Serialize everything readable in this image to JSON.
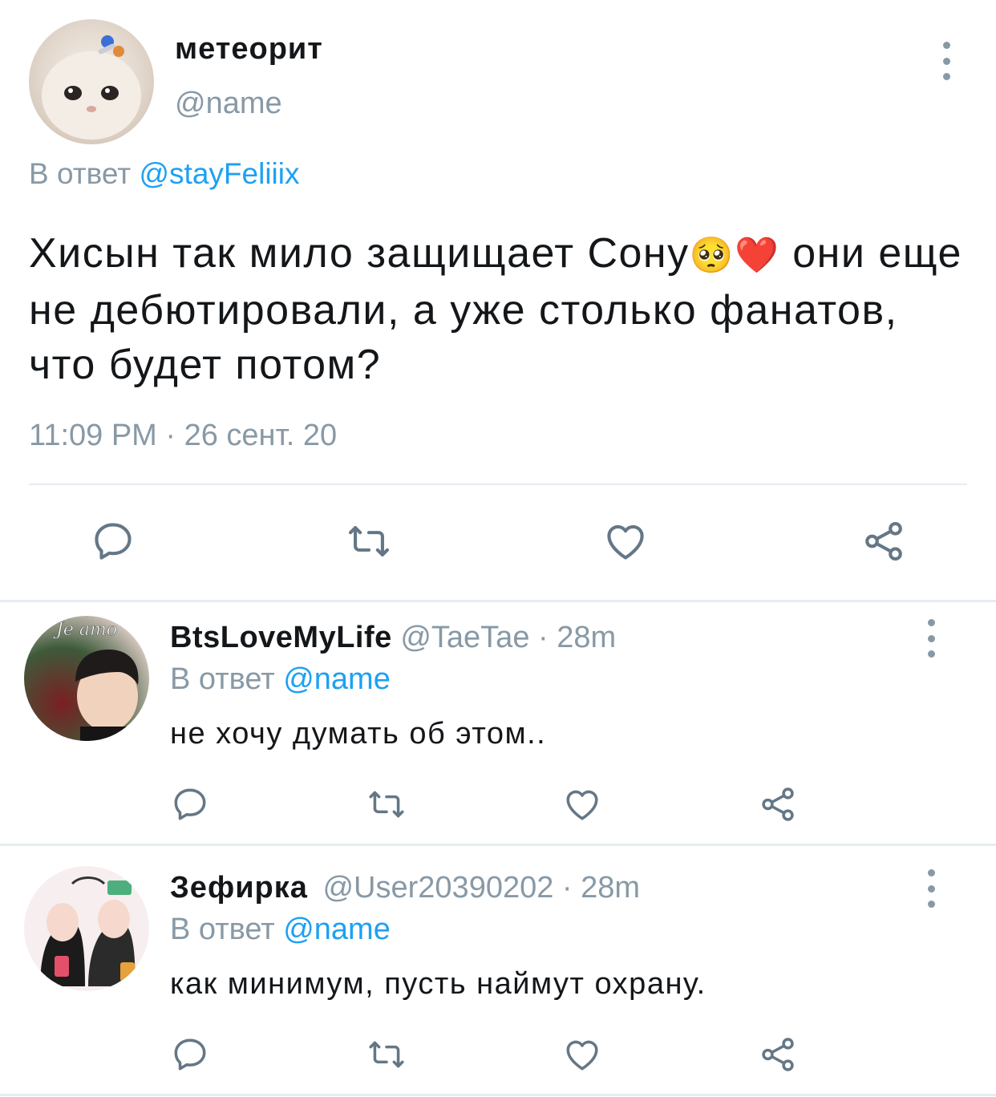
{
  "main_tweet": {
    "display_name": "метеорит",
    "handle": "@name",
    "reply_prefix": "В ответ",
    "reply_to": "@stayFeliiix",
    "text_part1": "Хисын так мило защищает Сону",
    "emoji1": "🥺",
    "emoji2": "❤️",
    "text_part2": "они еще не дебютировали, а уже столько фанатов, что будет потом?",
    "timestamp": "11:09 PM · 26 сент. 20"
  },
  "replies": [
    {
      "display_name": "BtsLoveMyLife",
      "meta": "@TaeTae · 28m",
      "reply_prefix": "В ответ",
      "reply_to": "@name",
      "text": "не хочу думать об этом..",
      "avatar_text": "Je amo"
    },
    {
      "display_name": "Зефирка",
      "meta": "@User20390202 · 28m",
      "reply_prefix": "В ответ",
      "reply_to": "@name",
      "text": "как минимум, пусть наймут охрану."
    }
  ],
  "colors": {
    "text": "#14171a",
    "muted": "#8899a6",
    "link": "#1da1f2",
    "divider": "#e6ecf0",
    "icon": "#657786"
  },
  "icons": [
    "more-icon",
    "reply-icon",
    "retweet-icon",
    "like-icon",
    "share-icon"
  ]
}
